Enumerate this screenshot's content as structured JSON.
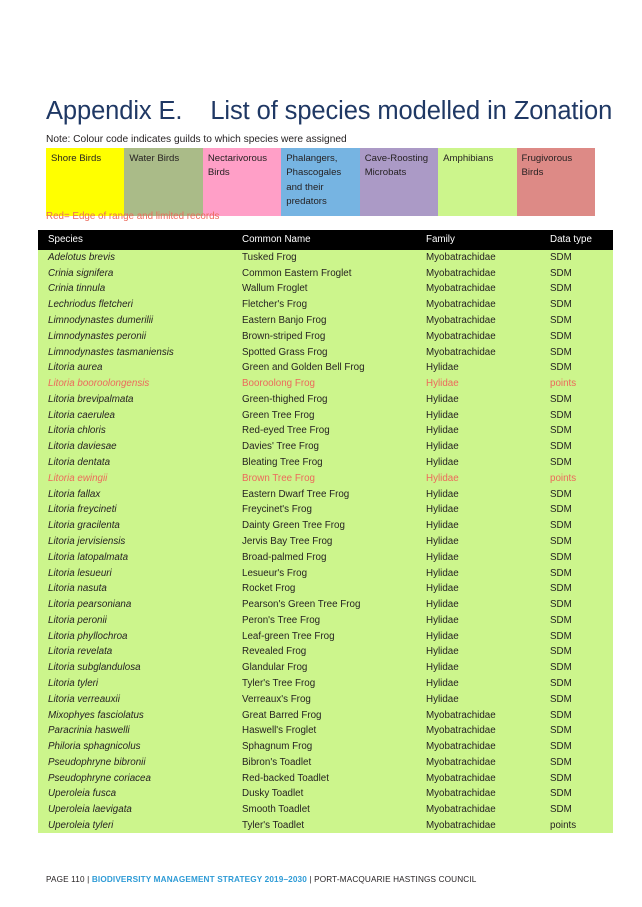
{
  "document": {
    "title": "Appendix E.    List of species modelled in Zonation",
    "note": "Note: Colour code indicates guilds to which species were assigned",
    "red_note": "Red= Edge of range and limited records",
    "title_color": "#1f3864",
    "red_color": "#ec6a5b",
    "row_color": "#ccf58c"
  },
  "legend": {
    "items": [
      {
        "label": "Shore Birds",
        "color": "#ffff00"
      },
      {
        "label": "Water Birds",
        "color": "#aabb88"
      },
      {
        "label": "Nectarivorous Birds",
        "color": "#ff9fc7"
      },
      {
        "label": "Phalangers, Phascogales and their predators",
        "color": "#76b4e2"
      },
      {
        "label": "Cave-Roosting Microbats",
        "color": "#ab9ac6"
      },
      {
        "label": "Amphibians",
        "color": "#ccf58c"
      },
      {
        "label": "Frugivorous Birds",
        "color": "#dd8a86"
      }
    ]
  },
  "table": {
    "columns": [
      "Species",
      "Common Name",
      "Family",
      "Data type"
    ],
    "rows": [
      {
        "species": "Adelotus brevis",
        "common": "Tusked Frog",
        "family": "Myobatrachidae",
        "datatype": "SDM",
        "red": false
      },
      {
        "species": "Crinia signifera",
        "common": "Common Eastern Froglet",
        "family": "Myobatrachidae",
        "datatype": "SDM",
        "red": false
      },
      {
        "species": "Crinia tinnula",
        "common": "Wallum Froglet",
        "family": "Myobatrachidae",
        "datatype": "SDM",
        "red": false
      },
      {
        "species": "Lechriodus fletcheri",
        "common": "Fletcher's Frog",
        "family": "Myobatrachidae",
        "datatype": "SDM",
        "red": false
      },
      {
        "species": "Limnodynastes dumerilii",
        "common": "Eastern Banjo Frog",
        "family": "Myobatrachidae",
        "datatype": "SDM",
        "red": false
      },
      {
        "species": "Limnodynastes peronii",
        "common": "Brown-striped Frog",
        "family": "Myobatrachidae",
        "datatype": "SDM",
        "red": false
      },
      {
        "species": "Limnodynastes tasmaniensis",
        "common": "Spotted Grass Frog",
        "family": "Myobatrachidae",
        "datatype": "SDM",
        "red": false
      },
      {
        "species": "Litoria aurea",
        "common": "Green and Golden Bell Frog",
        "family": "Hylidae",
        "datatype": "SDM",
        "red": false
      },
      {
        "species": "Litoria booroolongensis",
        "common": "Booroolong Frog",
        "family": "Hylidae",
        "datatype": "points",
        "red": true
      },
      {
        "species": "Litoria brevipalmata",
        "common": "Green-thighed Frog",
        "family": "Hylidae",
        "datatype": "SDM",
        "red": false
      },
      {
        "species": "Litoria caerulea",
        "common": "Green Tree Frog",
        "family": "Hylidae",
        "datatype": "SDM",
        "red": false
      },
      {
        "species": "Litoria chloris",
        "common": "Red-eyed Tree Frog",
        "family": "Hylidae",
        "datatype": "SDM",
        "red": false
      },
      {
        "species": "Litoria daviesae",
        "common": "Davies' Tree Frog",
        "family": "Hylidae",
        "datatype": "SDM",
        "red": false
      },
      {
        "species": "Litoria dentata",
        "common": "Bleating Tree Frog",
        "family": "Hylidae",
        "datatype": "SDM",
        "red": false
      },
      {
        "species": "Litoria ewingii",
        "common": "Brown Tree Frog",
        "family": "Hylidae",
        "datatype": "points",
        "red": true
      },
      {
        "species": "Litoria fallax",
        "common": "Eastern Dwarf Tree Frog",
        "family": "Hylidae",
        "datatype": "SDM",
        "red": false
      },
      {
        "species": "Litoria freycineti",
        "common": "Freycinet's Frog",
        "family": "Hylidae",
        "datatype": "SDM",
        "red": false
      },
      {
        "species": "Litoria gracilenta",
        "common": "Dainty Green Tree Frog",
        "family": "Hylidae",
        "datatype": "SDM",
        "red": false
      },
      {
        "species": "Litoria jervisiensis",
        "common": "Jervis Bay Tree Frog",
        "family": "Hylidae",
        "datatype": "SDM",
        "red": false
      },
      {
        "species": "Litoria latopalmata",
        "common": "Broad-palmed Frog",
        "family": "Hylidae",
        "datatype": "SDM",
        "red": false
      },
      {
        "species": "Litoria lesueuri",
        "common": "Lesueur's Frog",
        "family": "Hylidae",
        "datatype": "SDM",
        "red": false
      },
      {
        "species": "Litoria nasuta",
        "common": "Rocket Frog",
        "family": "Hylidae",
        "datatype": "SDM",
        "red": false
      },
      {
        "species": "Litoria pearsoniana",
        "common": "Pearson's Green Tree Frog",
        "family": "Hylidae",
        "datatype": "SDM",
        "red": false
      },
      {
        "species": "Litoria peronii",
        "common": "Peron's Tree Frog",
        "family": "Hylidae",
        "datatype": "SDM",
        "red": false
      },
      {
        "species": "Litoria phyllochroa",
        "common": "Leaf-green Tree Frog",
        "family": "Hylidae",
        "datatype": "SDM",
        "red": false
      },
      {
        "species": "Litoria revelata",
        "common": "Revealed Frog",
        "family": "Hylidae",
        "datatype": "SDM",
        "red": false
      },
      {
        "species": "Litoria subglandulosa",
        "common": "Glandular Frog",
        "family": "Hylidae",
        "datatype": "SDM",
        "red": false
      },
      {
        "species": "Litoria tyleri",
        "common": "Tyler's Tree Frog",
        "family": "Hylidae",
        "datatype": "SDM",
        "red": false
      },
      {
        "species": "Litoria verreauxii",
        "common": "Verreaux's Frog",
        "family": "Hylidae",
        "datatype": "SDM",
        "red": false
      },
      {
        "species": "Mixophyes fasciolatus",
        "common": "Great Barred Frog",
        "family": "Myobatrachidae",
        "datatype": "SDM",
        "red": false
      },
      {
        "species": "Paracrinia haswelli",
        "common": "Haswell's Froglet",
        "family": "Myobatrachidae",
        "datatype": "SDM",
        "red": false
      },
      {
        "species": "Philoria sphagnicolus",
        "common": "Sphagnum Frog",
        "family": "Myobatrachidae",
        "datatype": "SDM",
        "red": false
      },
      {
        "species": "Pseudophryne bibronii",
        "common": "Bibron's Toadlet",
        "family": "Myobatrachidae",
        "datatype": "SDM",
        "red": false
      },
      {
        "species": "Pseudophryne coriacea",
        "common": "Red-backed Toadlet",
        "family": "Myobatrachidae",
        "datatype": "SDM",
        "red": false
      },
      {
        "species": "Uperoleia fusca",
        "common": "Dusky Toadlet",
        "family": "Myobatrachidae",
        "datatype": "SDM",
        "red": false
      },
      {
        "species": "Uperoleia laevigata",
        "common": "Smooth Toadlet",
        "family": "Myobatrachidae",
        "datatype": "SDM",
        "red": false
      },
      {
        "species": "Uperoleia tyleri",
        "common": "Tyler's Toadlet",
        "family": "Myobatrachidae",
        "datatype": "points",
        "red": false
      }
    ]
  },
  "footer": {
    "page_label": "PAGE 110",
    "separator_1": "|",
    "brand": "BIODIVERSITY MANAGEMENT STRATEGY 2019–2030",
    "separator_2": "|",
    "council": "PORT-MACQUARIE HASTINGS COUNCIL",
    "brand_color": "#2e9bd6"
  }
}
